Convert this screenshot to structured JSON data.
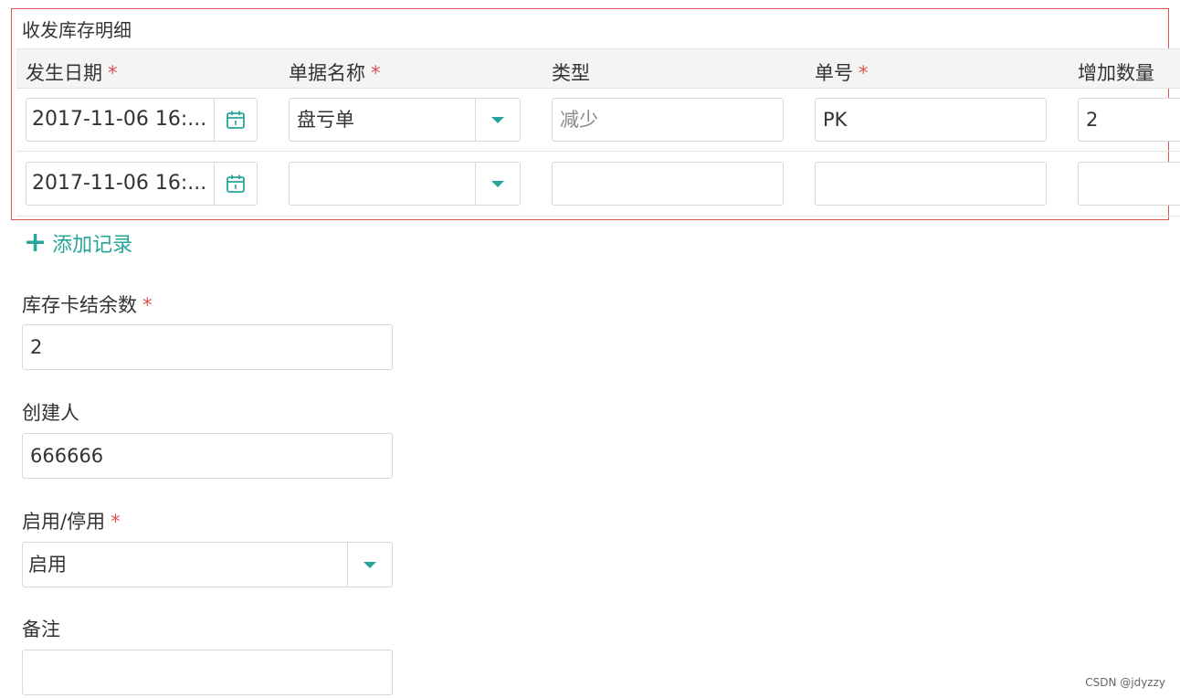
{
  "section": {
    "title": "收发库存明细"
  },
  "columns": [
    {
      "label": "发生日期",
      "required": "*"
    },
    {
      "label": "单据名称",
      "required": "*"
    },
    {
      "label": "类型",
      "required": ""
    },
    {
      "label": "单号",
      "required": "*"
    },
    {
      "label": "增加数量",
      "required": ""
    }
  ],
  "rows": [
    {
      "date": "2017-11-06 16:...",
      "doc_name": "盘亏单",
      "type": "减少",
      "number": "PK",
      "quantity": "2"
    },
    {
      "date": "2017-11-06 16:...",
      "doc_name": "",
      "type": "",
      "number": "",
      "quantity": ""
    }
  ],
  "add_record": {
    "icon": "plus-icon",
    "label": "添加记录"
  },
  "form": {
    "balance": {
      "label": "库存卡结余数",
      "required": "*",
      "value": "2"
    },
    "creator": {
      "label": "创建人",
      "value": "666666"
    },
    "status": {
      "label": "启用/停用",
      "required": "*",
      "value": "启用"
    },
    "remark": {
      "label": "备注",
      "value": ""
    }
  },
  "watermark": "CSDN @jdyzzy",
  "colors": {
    "accent": "#26a69a",
    "required": "#d9534f",
    "highlight_border": "#d9534f"
  }
}
